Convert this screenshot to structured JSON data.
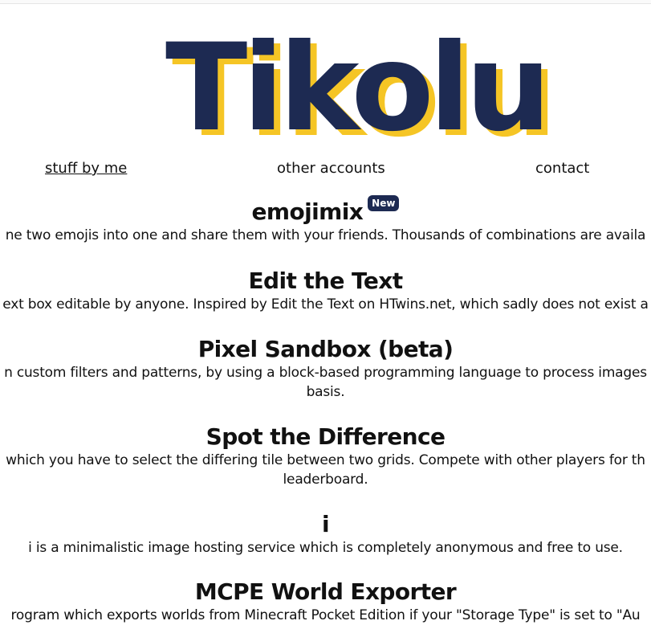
{
  "site": {
    "logo_text": "Tikolu",
    "colors": {
      "logo_main": "#1d2a52",
      "logo_shadow": "#f5c525",
      "badge_bg": "#1d2a52"
    }
  },
  "nav": {
    "items": [
      {
        "label": "stuff by me"
      },
      {
        "label": "other accounts"
      },
      {
        "label": "contact"
      }
    ]
  },
  "projects": [
    {
      "title": "emojimix",
      "badge": "New",
      "lines": [
        "ne two emojis into one and share them with your friends. Thousands of combinations are availa"
      ]
    },
    {
      "title": "Edit the Text",
      "lines": [
        "ext box editable by anyone. Inspired by Edit the Text on HTwins.net, which sadly does not exist a"
      ]
    },
    {
      "title": "Pixel Sandbox (beta)",
      "lines": [
        "n custom filters and patterns, by using a block-based programming language to process images",
        "basis."
      ]
    },
    {
      "title": "Spot the Difference",
      "lines": [
        "which you have to select the differing tile between two grids. Compete with other players for th",
        "leaderboard."
      ]
    },
    {
      "title": "i",
      "lines": [
        "i is a minimalistic image hosting service which is completely anonymous and free to use."
      ]
    },
    {
      "title": "MCPE World Exporter",
      "lines": [
        "rogram which exports worlds from Minecraft Pocket Edition if your \"Storage Type\" is set to \"Au"
      ]
    }
  ]
}
